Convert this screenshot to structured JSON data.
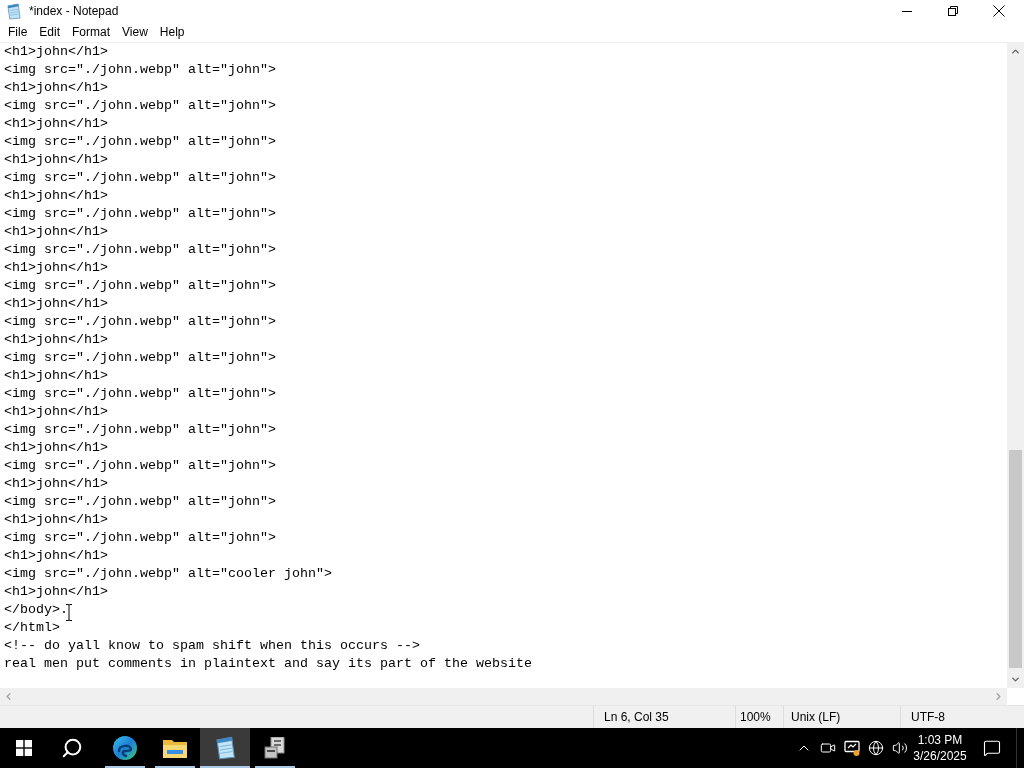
{
  "window": {
    "title": "*index - Notepad"
  },
  "menu": [
    {
      "label": "File"
    },
    {
      "label": "Edit"
    },
    {
      "label": "Format"
    },
    {
      "label": "View"
    },
    {
      "label": "Help"
    }
  ],
  "editor": {
    "lines": [
      "<h1>john</h1>",
      "<img src=\"./john.webp\" alt=\"john\">",
      "<h1>john</h1>",
      "<img src=\"./john.webp\" alt=\"john\">",
      "<h1>john</h1>",
      "<img src=\"./john.webp\" alt=\"john\">",
      "<h1>john</h1>",
      "<img src=\"./john.webp\" alt=\"john\">",
      "<h1>john</h1>",
      "<img src=\"./john.webp\" alt=\"john\">",
      "<h1>john</h1>",
      "<img src=\"./john.webp\" alt=\"john\">",
      "<h1>john</h1>",
      "<img src=\"./john.webp\" alt=\"john\">",
      "<h1>john</h1>",
      "<img src=\"./john.webp\" alt=\"john\">",
      "<h1>john</h1>",
      "<img src=\"./john.webp\" alt=\"john\">",
      "<h1>john</h1>",
      "<img src=\"./john.webp\" alt=\"john\">",
      "<h1>john</h1>",
      "<img src=\"./john.webp\" alt=\"john\">",
      "<h1>john</h1>",
      "<img src=\"./john.webp\" alt=\"john\">",
      "<h1>john</h1>",
      "<img src=\"./john.webp\" alt=\"john\">",
      "<h1>john</h1>",
      "<img src=\"./john.webp\" alt=\"john\">",
      "<h1>john</h1>",
      "<img src=\"./john.webp\" alt=\"cooler john\">",
      "<h1>john</h1>",
      "</body>.",
      "</html>",
      "<!-- do yall know to spam shift when this occurs -->",
      "real men put comments in plaintext and say its part of the website"
    ]
  },
  "status_bar": {
    "position": "Ln 6, Col 35",
    "zoom": "100%",
    "line_ending": "Unix (LF)",
    "encoding": "UTF-8"
  },
  "taskbar": {
    "apps": [
      {
        "kind": "browser",
        "running": true,
        "selected": false
      },
      {
        "kind": "folder",
        "running": true,
        "selected": false
      },
      {
        "kind": "notepad",
        "running": true,
        "selected": true
      },
      {
        "kind": "box",
        "running": true,
        "selected": false
      }
    ],
    "clock": {
      "time": "1:03 PM",
      "date": "3/26/2025"
    }
  }
}
